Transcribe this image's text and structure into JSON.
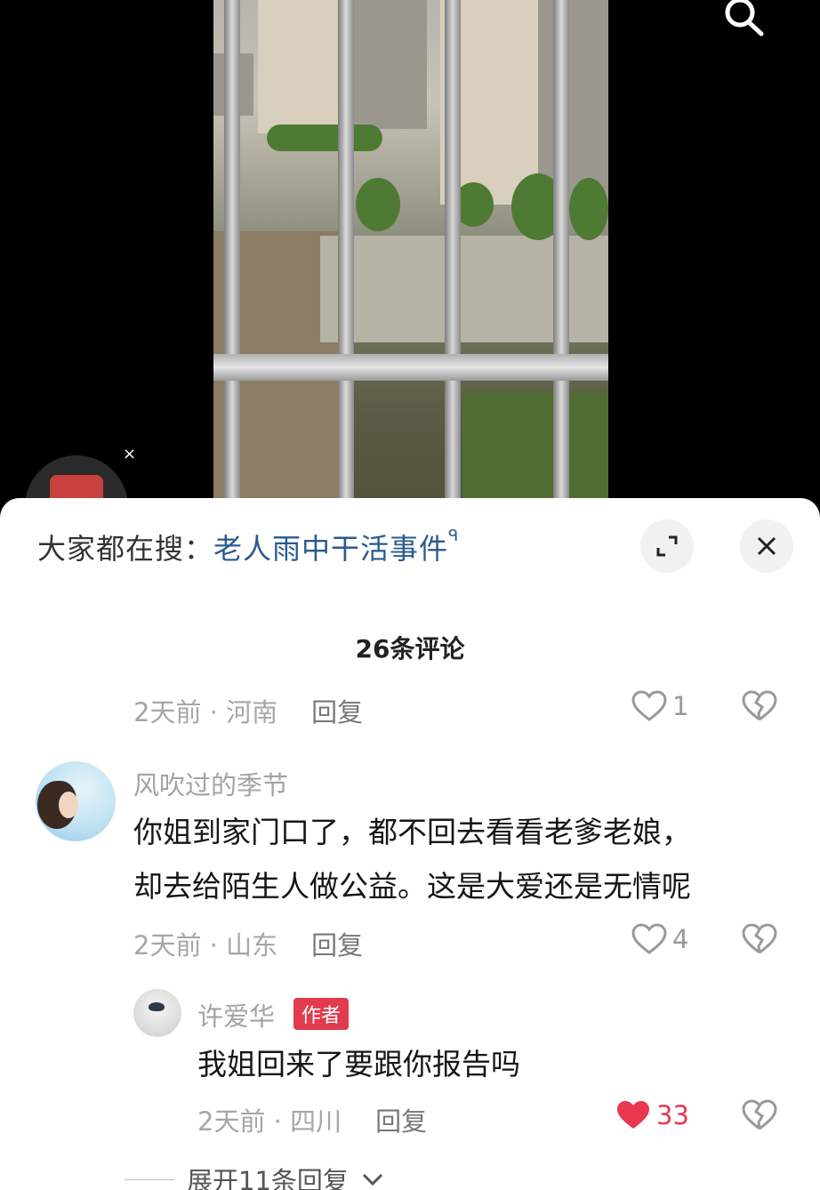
{
  "colors": {
    "accent_red": "#e8374f",
    "keyword_blue": "#2b5a8f",
    "sheet_bg": "#ffffff"
  },
  "top": {
    "search_icon": "search-icon",
    "float_close": "×"
  },
  "sheet": {
    "search_prefix": "大家都在搜：",
    "search_keyword": "老人雨中干活事件",
    "search_mini_icon": "ᑫ",
    "expand_icon": "expand-icon",
    "close_icon": "close-icon",
    "comment_count_title": "26条评论"
  },
  "comments": [
    {
      "meta_time_loc": "2天前 · 河南",
      "reply_label": "回复",
      "likes": "1",
      "liked": false
    },
    {
      "username": "风吹过的季节",
      "line1": "你姐到家门口了，都不回去看看老爹老娘，",
      "line2": "却去给陌生人做公益。这是大爱还是无情呢",
      "meta_time_loc": "2天前 · 山东",
      "reply_label": "回复",
      "likes": "4",
      "liked": false
    },
    {
      "username": "许爱华",
      "badge": "作者",
      "text": "我姐回来了要跟你报告吗",
      "meta_time_loc": "2天前 · 四川",
      "reply_label": "回复",
      "likes": "33",
      "liked": true
    }
  ],
  "expand_replies": {
    "label": "展开11条回复",
    "chevron": "chevron-down-icon"
  }
}
